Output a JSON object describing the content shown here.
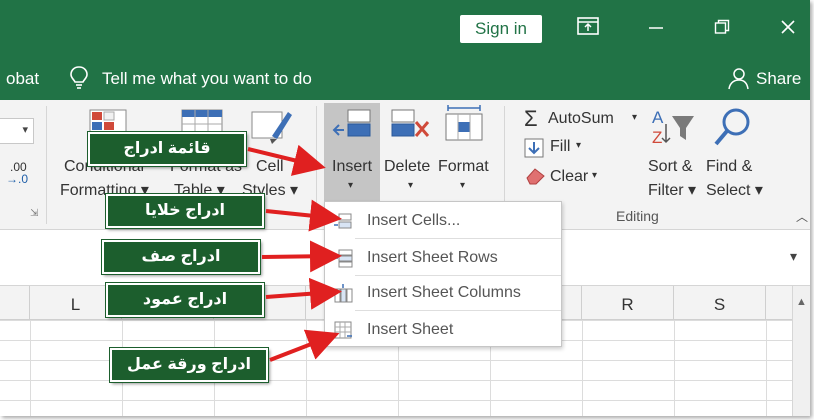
{
  "titlebar": {
    "sign_in": "Sign in"
  },
  "tellbar": {
    "left_fragment": "obat",
    "tell_me": "Tell me what you want to do",
    "share": "Share"
  },
  "ribbon": {
    "cond_format": [
      "Conditional",
      "Formatting ▾"
    ],
    "format_table": [
      "Format as",
      "Table ▾"
    ],
    "cell_styles": [
      "Cell",
      "Styles ▾"
    ],
    "insert": "Insert",
    "delete": "Delete",
    "format": "Format",
    "autosum": "AutoSum",
    "fill": "Fill",
    "clear": "Clear",
    "sort_filter": [
      "Sort &",
      "Filter ▾"
    ],
    "find_select": [
      "Find &",
      "Select ▾"
    ],
    "editing_group": "Editing",
    "num_dec": [
      ".00",
      "→.0"
    ]
  },
  "insert_menu": {
    "items": [
      "Insert Cells...",
      "Insert Sheet Rows",
      "Insert Sheet Columns",
      "Insert Sheet"
    ]
  },
  "columns": [
    "L",
    "R",
    "S"
  ],
  "callouts": {
    "insert_list": "قائمة ادراج",
    "insert_cells": "ادراج خلايا",
    "insert_row": "ادراج صف",
    "insert_column": "ادراج عمود",
    "insert_sheet": "ادراج ورقة عمل"
  },
  "colors": {
    "excel_green": "#217346",
    "callout_green": "#1c5e2d",
    "arrow_red": "#e02020"
  }
}
